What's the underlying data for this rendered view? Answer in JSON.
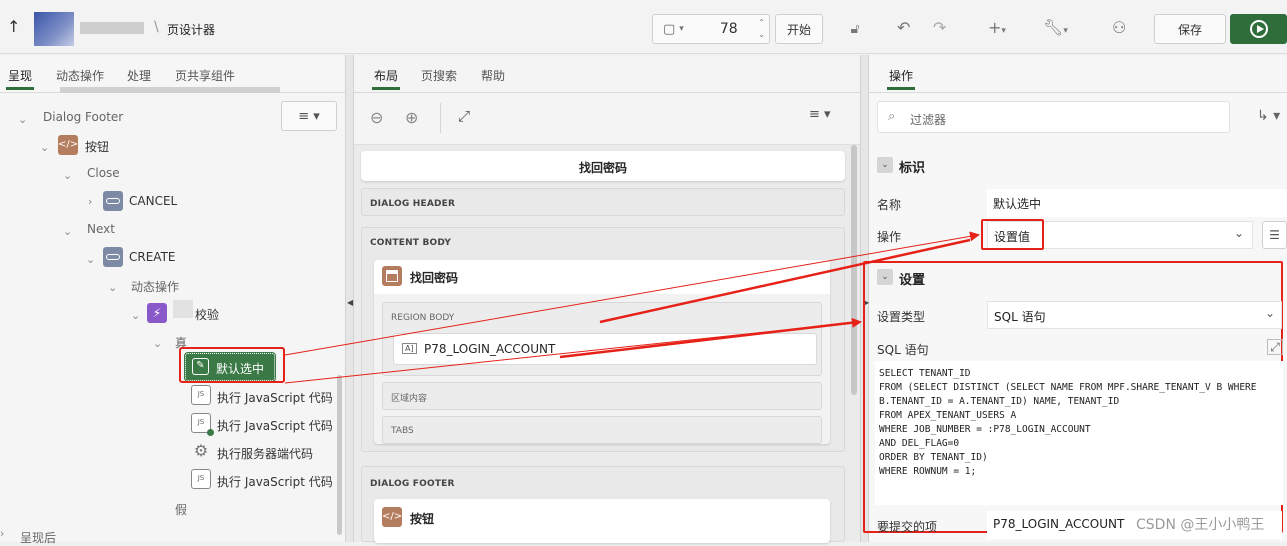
{
  "topbar": {
    "breadcrumb_title": "页设计器",
    "page_number": "78",
    "start_label": "开始",
    "save_label": "保存"
  },
  "left": {
    "tabs": [
      "呈现",
      "动态操作",
      "处理",
      "页共享组件"
    ],
    "tree": {
      "dialog_footer": "Dialog Footer",
      "buttons": "按钮",
      "close": "Close",
      "cancel": "CANCEL",
      "next": "Next",
      "create": "CREATE",
      "dynamic_actions": "动态操作",
      "validation": "校验",
      "true_label": "真",
      "default_selected": "默认选中",
      "exec_js_1": "执行 JavaScript 代码",
      "exec_js_2": "执行 JavaScript 代码",
      "exec_server": "执行服务器端代码",
      "exec_js_3": "执行 JavaScript 代码",
      "false_label": "假",
      "after_render": "呈现后"
    }
  },
  "middle": {
    "tabs": [
      "布局",
      "页搜索",
      "帮助"
    ],
    "page_title": "找回密码",
    "dialog_header": "DIALOG HEADER",
    "content_body": "CONTENT BODY",
    "region_name": "找回密码",
    "region_body": "REGION BODY",
    "item_badge": "A]",
    "item_name": "P78_LOGIN_ACCOUNT",
    "region_content": "区域内容",
    "tabs_label": "TABS",
    "dialog_footer": "DIALOG FOOTER",
    "buttons_label": "按钮"
  },
  "right": {
    "tab": "操作",
    "filter_placeholder": "过滤器",
    "identity_header": "标识",
    "name_label": "名称",
    "name_value": "默认选中",
    "action_label": "操作",
    "action_value": "设置值",
    "settings_header": "设置",
    "set_type_label": "设置类型",
    "set_type_value": "SQL 语句",
    "sql_label": "SQL 语句",
    "sql_code": "SELECT TENANT_ID\nFROM (SELECT DISTINCT (SELECT NAME FROM MPF.SHARE_TENANT_V B WHERE\nB.TENANT_ID = A.TENANT_ID) NAME, TENANT_ID\nFROM APEX_TENANT_USERS A\nWHERE JOB_NUMBER = :P78_LOGIN_ACCOUNT\nAND DEL_FLAG=0\nORDER BY TENANT_ID)\nWHERE ROWNUM = 1;",
    "submit_items_label": "要提交的项",
    "submit_items_value": "P78_LOGIN_ACCOUNT"
  },
  "watermark": "CSDN @王小小鸭王",
  "colors": {
    "accent_green": "#2f6e3b",
    "highlight_red": "#e62117",
    "icon_brown": "#b57d5f",
    "icon_purple": "#8a59c9"
  }
}
